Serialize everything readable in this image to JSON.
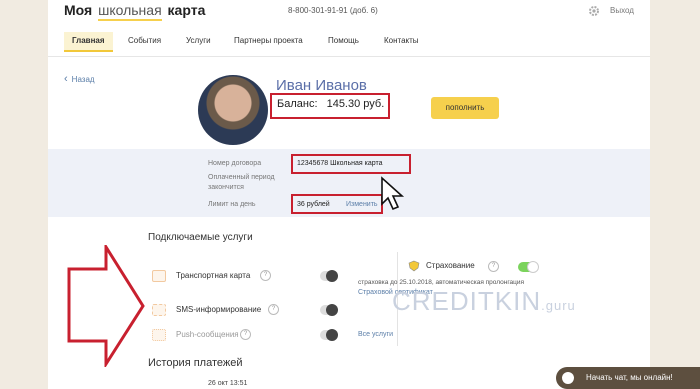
{
  "header": {
    "logo_left": "Моя",
    "logo_mid": "школьная",
    "logo_right": "карта",
    "phone": "8-800-301-91-91 (доб. 6)",
    "exit": "Выход"
  },
  "nav": {
    "items": [
      "Главная",
      "События",
      "Услуги",
      "Партнеры проекта",
      "Помощь",
      "Контакты"
    ]
  },
  "profile": {
    "back": "Назад",
    "name": "Иван Иванов",
    "balance_label": "Баланс:",
    "balance_value": "145.30 руб.",
    "topup": "пополнить"
  },
  "contract": {
    "number_label": "Номер договора",
    "number_value": "12345678 Школьная карта",
    "period_label_1": "Оплаченный период",
    "period_label_2": "закончится",
    "limit_label": "Лимит на день",
    "limit_value": "36 рублей",
    "limit_change": "Изменить"
  },
  "services": {
    "title": "Подключаемые услуги",
    "items": [
      {
        "label": "Транспортная карта",
        "enabled": false
      },
      {
        "label": "SMS-информирование",
        "enabled": false
      },
      {
        "label": "Push-сообщения",
        "enabled": false
      }
    ],
    "insurance": {
      "label": "Страхование",
      "enabled": true,
      "note": "страховка до 25.10.2018, автоматическая пролонгация",
      "link": "Страховой сертификат"
    },
    "all_services": "Все услуги"
  },
  "history": {
    "title": "История платежей",
    "first_date": "26 окт 13:51"
  },
  "watermark": {
    "main": "CREDITKIN",
    "suffix": ".guru"
  },
  "chat": {
    "label": "Начать чат, мы онлайн!"
  },
  "colors": {
    "accent_yellow": "#f6d04d",
    "highlight_red": "#c8202f",
    "link_blue": "#5b7ea8",
    "toggle_on": "#7bd35c"
  }
}
